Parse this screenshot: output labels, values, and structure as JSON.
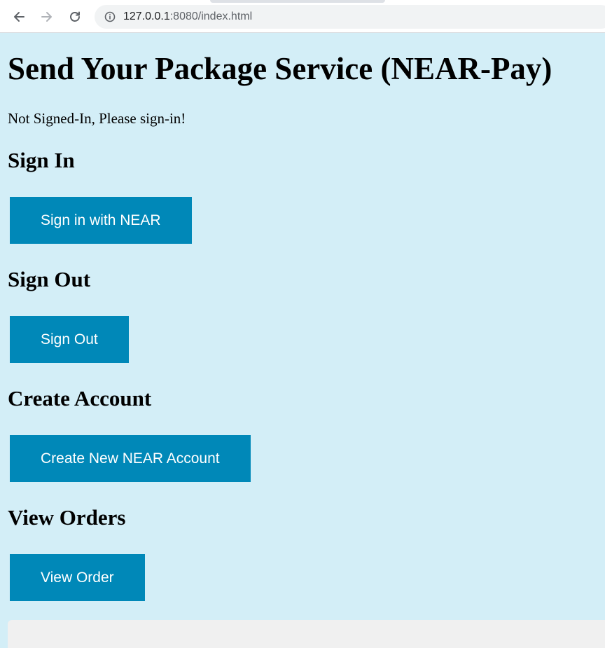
{
  "browser": {
    "url_host": "127.0.0.1",
    "url_rest": ":8080/index.html",
    "icons": [
      "back-arrow-icon",
      "forward-arrow-icon",
      "reload-icon",
      "info-icon"
    ]
  },
  "page": {
    "title": "Send Your Package Service (NEAR-Pay)",
    "status": "Not Signed-In, Please sign-in!",
    "sections": {
      "sign_in": {
        "heading": "Sign In",
        "button": "Sign in with NEAR"
      },
      "sign_out": {
        "heading": "Sign Out",
        "button": "Sign Out"
      },
      "create_account": {
        "heading": "Create Account",
        "button": "Create New NEAR Account"
      },
      "view_orders": {
        "heading": "View Orders",
        "button": "View Order"
      }
    }
  },
  "colors": {
    "page_background": "#d3eef7",
    "button_background": "#0088b8",
    "button_text": "#ffffff"
  }
}
